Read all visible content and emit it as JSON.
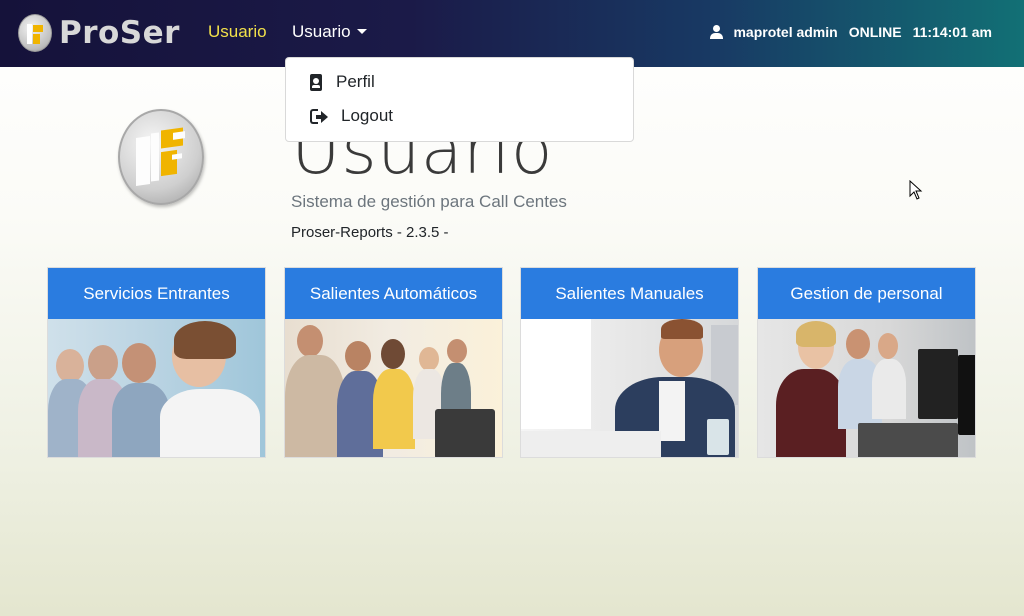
{
  "brand": {
    "name": "ProSer"
  },
  "nav": {
    "active_link": "Usuario",
    "dropdown_label": "Usuario",
    "user_name": "maprotel admin",
    "status": "ONLINE",
    "time": "11:14:01 am"
  },
  "dropdown": {
    "items": [
      {
        "label": "Perfil",
        "icon": "id-badge-icon"
      },
      {
        "label": "Logout",
        "icon": "sign-out-icon"
      }
    ]
  },
  "hero": {
    "title": "Usuario",
    "subtitle": "Sistema de gestión para Call Centes",
    "version": "Proser-Reports - 2.3.5 -"
  },
  "cards": [
    {
      "label": "Servicios Entrantes"
    },
    {
      "label": "Salientes Automáticos"
    },
    {
      "label": "Salientes Manuales"
    },
    {
      "label": "Gestion de personal"
    }
  ],
  "colors": {
    "navbar_start": "#15123a",
    "navbar_end": "#127075",
    "active_link": "#f1e04a",
    "card_header": "#2a7ce0"
  }
}
